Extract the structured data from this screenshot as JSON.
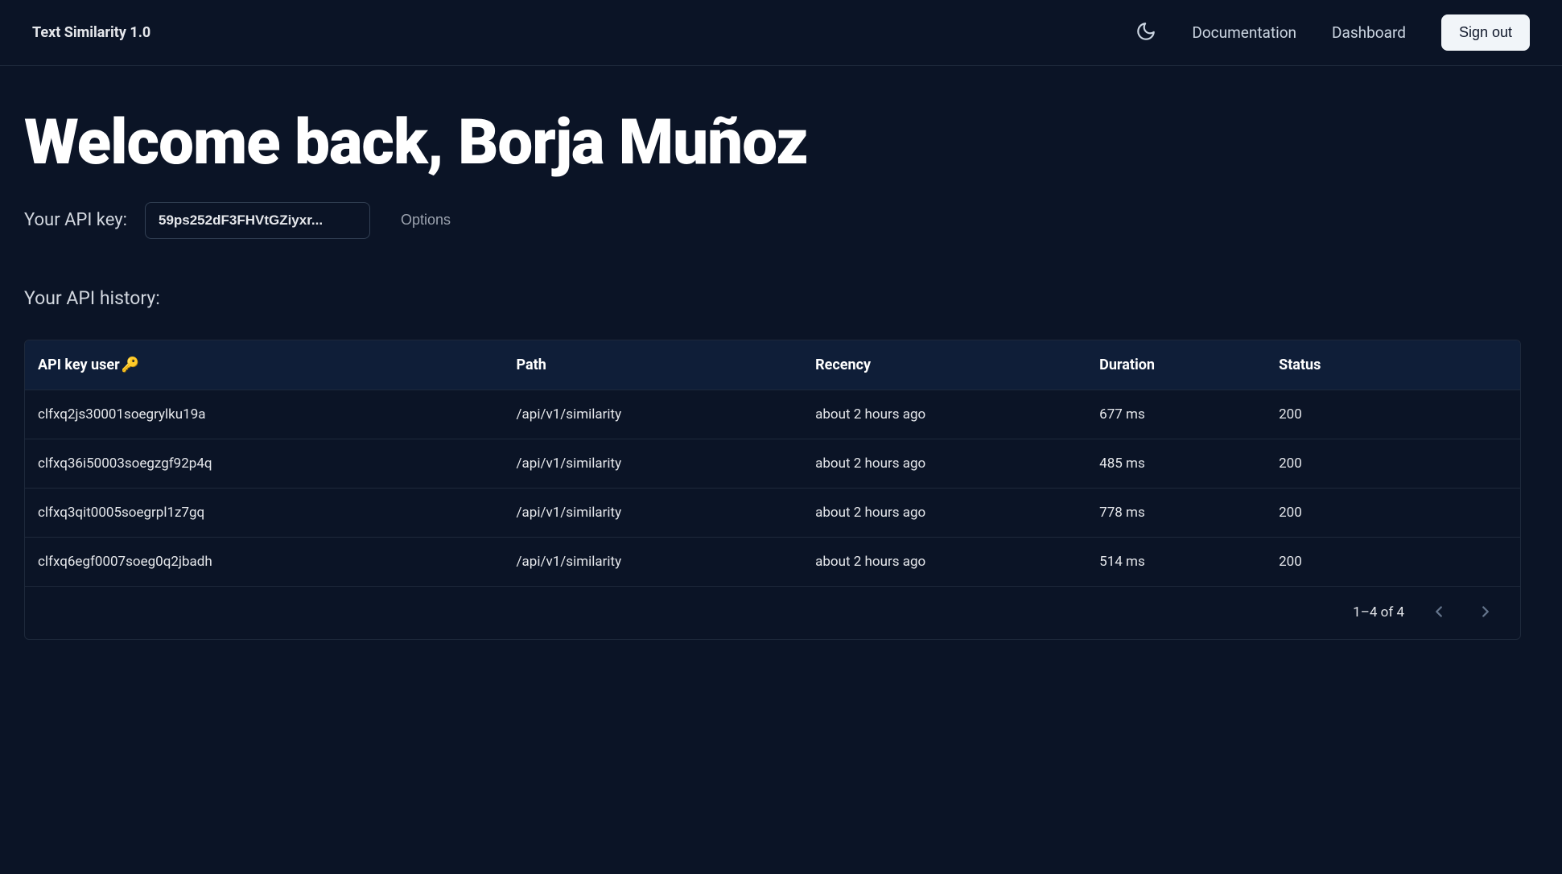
{
  "nav": {
    "brand": "Text Similarity 1.0",
    "links": {
      "documentation": "Documentation",
      "dashboard": "Dashboard"
    },
    "signout": "Sign out"
  },
  "main": {
    "welcome": "Welcome back, Borja Muñoz",
    "apikey_label": "Your API key:",
    "apikey_value": "59ps252dF3FHVtGZiyxr...",
    "options_label": "Options",
    "history_label": "Your API history:"
  },
  "table": {
    "columns": {
      "user": "API key user",
      "user_emoji": "🔑",
      "path": "Path",
      "recency": "Recency",
      "duration": "Duration",
      "status": "Status"
    },
    "rows": [
      {
        "user": "clfxq2js30001soegrylku19a",
        "path": "/api/v1/similarity",
        "recency": "about 2 hours ago",
        "duration": "677 ms",
        "status": "200"
      },
      {
        "user": "clfxq36i50003soegzgf92p4q",
        "path": "/api/v1/similarity",
        "recency": "about 2 hours ago",
        "duration": "485 ms",
        "status": "200"
      },
      {
        "user": "clfxq3qit0005soegrpl1z7gq",
        "path": "/api/v1/similarity",
        "recency": "about 2 hours ago",
        "duration": "778 ms",
        "status": "200"
      },
      {
        "user": "clfxq6egf0007soeg0q2jbadh",
        "path": "/api/v1/similarity",
        "recency": "about 2 hours ago",
        "duration": "514 ms",
        "status": "200"
      }
    ],
    "footer": {
      "range": "1–4 of 4"
    }
  }
}
